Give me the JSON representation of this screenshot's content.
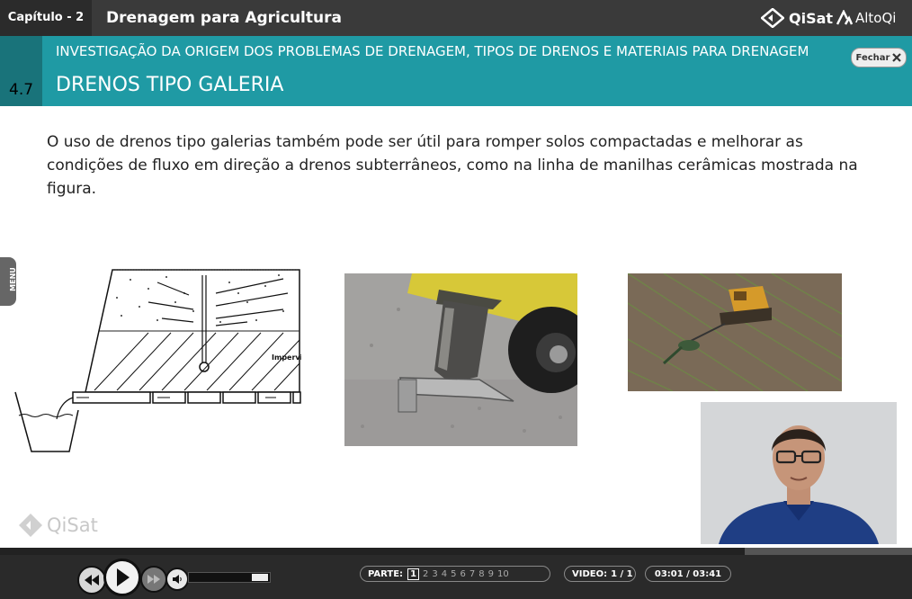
{
  "header": {
    "chapter": "Capítulo - 2",
    "course": "Drenagem para Agricultura",
    "logo_qisat": "QiSat",
    "logo_altoqi": "AltoQi"
  },
  "section": {
    "number": "4.7",
    "subtitle": "INVESTIGAÇÃO DA ORIGEM DOS PROBLEMAS DE DRENAGEM, TIPOS DE DRENOS E MATERIAIS PARA DRENAGEM",
    "title": "DRENOS TIPO GALERIA",
    "close_label": "Fechar"
  },
  "body": {
    "paragraph": "O uso de drenos tipo galerias também pode ser útil para romper solos compactadas e melhorar as condições de fluxo em direção a drenos subterrâneos, como na linha de manilhas cerâmicas mostrada na figura.",
    "figure1_label": "Impervi"
  },
  "menu_tab_label": "MENU",
  "watermark": "QiSat",
  "player": {
    "progress": 0.817,
    "parts_label": "PARTE:",
    "parts": [
      "1",
      "2",
      "3",
      "4",
      "5",
      "6",
      "7",
      "8",
      "9",
      "10"
    ],
    "active_part": "1",
    "video_label": "VIDEO:",
    "video_value": "1 / 1",
    "time": "03:01 / 03:41"
  }
}
